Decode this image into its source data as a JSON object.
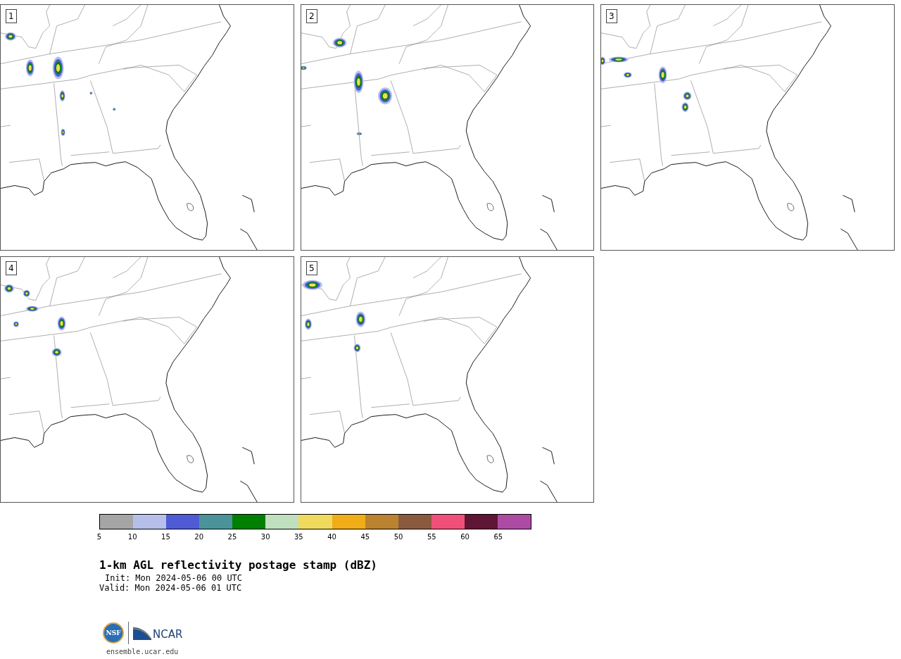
{
  "panels": [
    {
      "number": "1"
    },
    {
      "number": "2"
    },
    {
      "number": "3"
    },
    {
      "number": "4"
    },
    {
      "number": "5"
    }
  ],
  "colorbar": {
    "bins": [
      {
        "color": "#a5a5a5"
      },
      {
        "color": "#b5bfea"
      },
      {
        "color": "#4f5bd5"
      },
      {
        "color": "#4a9499"
      },
      {
        "color": "#008000"
      },
      {
        "color": "#bfdfbf"
      },
      {
        "color": "#f0da5e"
      },
      {
        "color": "#f0ad17"
      },
      {
        "color": "#bb832f"
      },
      {
        "color": "#8b5a3e"
      },
      {
        "color": "#f05078"
      },
      {
        "color": "#5e1634"
      },
      {
        "color": "#ad4ba4"
      }
    ],
    "ticks": [
      "5",
      "10",
      "15",
      "20",
      "25",
      "30",
      "35",
      "40",
      "45",
      "50",
      "55",
      "60",
      "65"
    ]
  },
  "title": "1-km AGL reflectivity postage stamp (dBZ)",
  "init": "Init: Mon 2024-05-06 00 UTC",
  "valid": "Valid: Mon 2024-05-06 01 UTC",
  "logo": {
    "nsf": "NSF",
    "ncar": "NCAR"
  },
  "url": "ensemble.ucar.edu"
}
